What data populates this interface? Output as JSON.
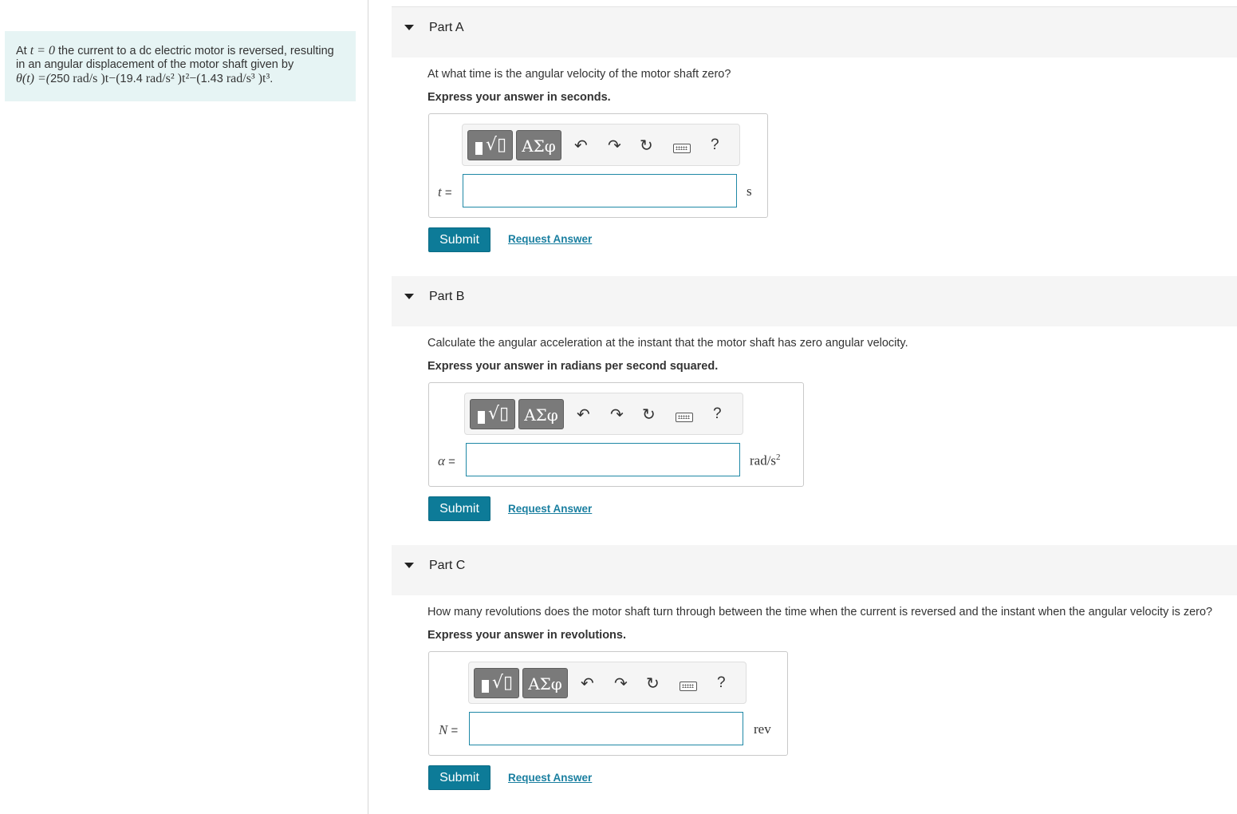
{
  "intro": {
    "prefix": "At ",
    "t0": "t = 0",
    "text1": " the current to a dc electric motor is reversed, resulting in an angular displacement of the motor shaft given by",
    "eq_lhs": "θ(t) =(",
    "c1": "250",
    "u1": " rad/s )t−(",
    "c2": "19.4",
    "u2": " rad/s² )t²−(",
    "c3": "1.43",
    "u3": " rad/s³ )t³",
    "end": "."
  },
  "toolbar": {
    "greek_label": "ΑΣφ",
    "help_label": "?",
    "icons": [
      "templates-icon",
      "greek-symbols-icon",
      "undo-icon",
      "redo-icon",
      "reset-icon",
      "keyboard-icon",
      "help-icon"
    ]
  },
  "parts": [
    {
      "title": "Part A",
      "question": "At what time is the angular velocity of the motor shaft zero?",
      "instruction": "Express your answer in seconds.",
      "variable": "t",
      "equals": " =",
      "value": "",
      "unit": "s",
      "submit_label": "Submit",
      "request_label": "Request Answer"
    },
    {
      "title": "Part B",
      "question": "Calculate the angular acceleration at the instant that the motor shaft has zero angular velocity.",
      "instruction": "Express your answer in radians per second squared.",
      "variable": "α",
      "equals": " =",
      "value": "",
      "unit": "rad/s",
      "unit_sup": "2",
      "submit_label": "Submit",
      "request_label": "Request Answer"
    },
    {
      "title": "Part C",
      "question": "How many revolutions does the motor shaft turn through between the time when the current is reversed and the instant when the angular velocity is zero?",
      "instruction": "Express your answer in revolutions.",
      "variable": "N",
      "equals": " =",
      "value": "",
      "unit": "rev",
      "submit_label": "Submit",
      "request_label": "Request Answer"
    }
  ],
  "colors": {
    "intro_bg": "#e6f4f4",
    "submit_bg": "#0d7b98",
    "link": "#1a7fa0",
    "input_border": "#1f88a6"
  }
}
